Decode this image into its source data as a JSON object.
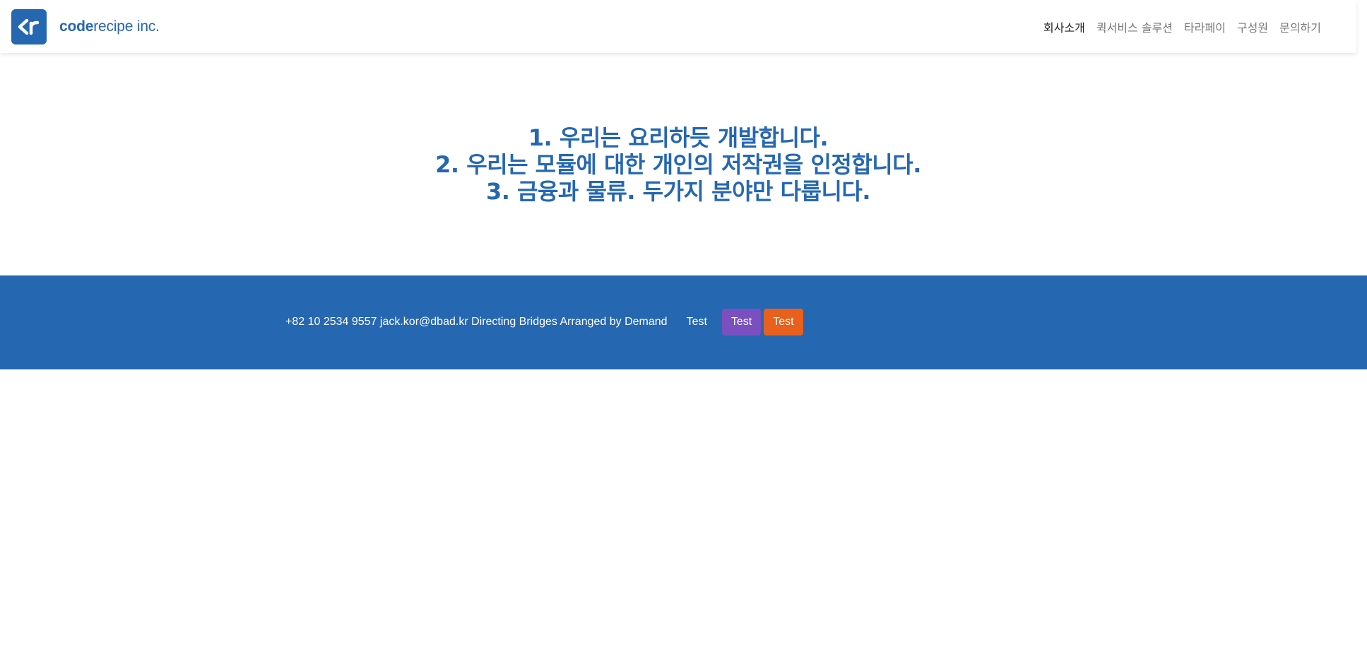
{
  "brand": {
    "logo_letters": "<r",
    "name_bold": "code",
    "name_light": "recipe inc."
  },
  "nav": {
    "items": [
      {
        "label": "회사소개",
        "active": true
      },
      {
        "label": "퀵서비스 솔루션",
        "active": false
      },
      {
        "label": "타라페이",
        "active": false
      },
      {
        "label": "구성원",
        "active": false
      },
      {
        "label": "문의하기",
        "active": false
      }
    ]
  },
  "hero": {
    "lines": [
      "1. 우리는 요리하듯 개발합니다.",
      "2. 우리는 모듈에 대한 개인의 저작권을 인정합니다.",
      "3. 금융과 물류. 두가지 분야만 다룹니다."
    ]
  },
  "footer": {
    "text": "+82 10 2534 9557 jack.kor@dbad.kr Directing Bridges Arranged by Demand",
    "buttons": [
      {
        "label": "Test",
        "style": "link"
      },
      {
        "label": "Test",
        "style": "purple"
      },
      {
        "label": "Test",
        "style": "orange"
      }
    ]
  },
  "colors": {
    "brand_blue": "#2567b1",
    "nav_text": "#777777",
    "nav_active": "#222222",
    "footer_bg": "#2567b1",
    "button_purple": "#7a4fbf",
    "button_orange": "#e8601c",
    "white": "#ffffff"
  }
}
